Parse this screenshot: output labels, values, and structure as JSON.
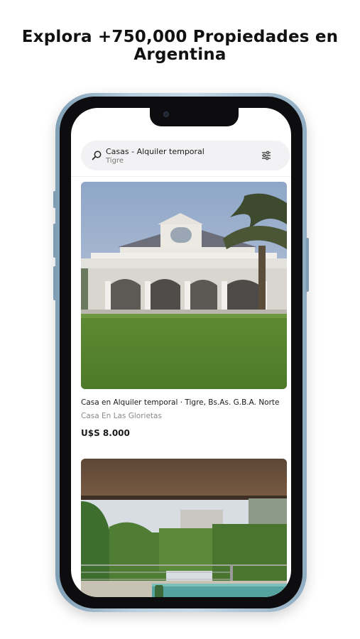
{
  "headline": {
    "line1": "Explora +750,000 Propiedades en",
    "line2": "Argentina"
  },
  "search": {
    "title": "Casas - Alquiler temporal",
    "location": "Tigre",
    "icon": "search-icon",
    "filter_icon": "sliders-icon"
  },
  "listings": [
    {
      "title": "Casa en Alquiler temporal · Tigre, Bs.As. G.B.A. Norte",
      "subtitle": "Casa En Las Glorietas",
      "price": "U$S 8.000"
    }
  ],
  "colors": {
    "phone_frame": "#a9c3d5",
    "bezel": "#0d0d0f",
    "search_bg": "#f2f2f4"
  }
}
